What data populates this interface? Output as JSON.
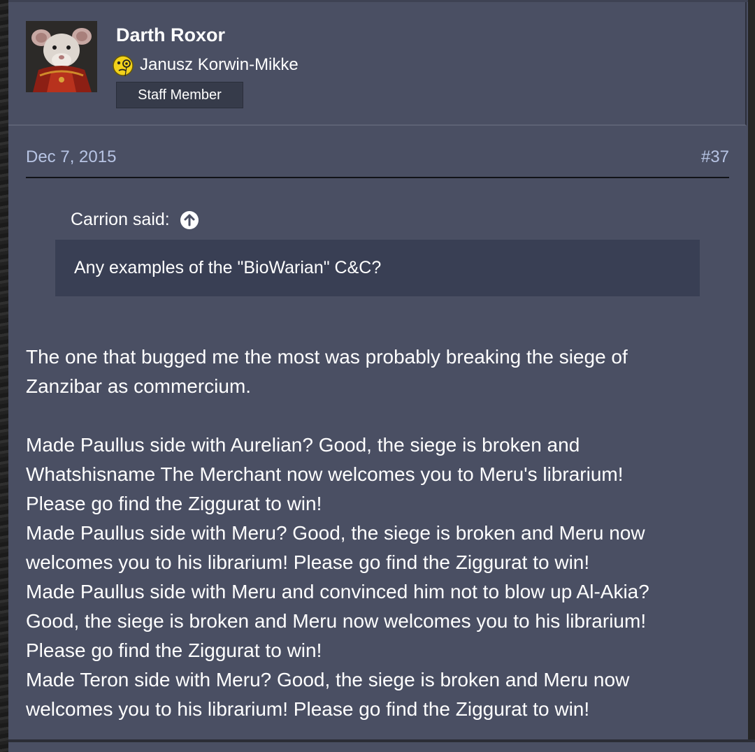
{
  "user": {
    "name": "Darth Roxor",
    "title": "Janusz Korwin-Mikke",
    "badge": "Staff Member",
    "avatar_icon": "rat-warrior-avatar",
    "title_icon": "monocle-smiley-icon"
  },
  "post": {
    "date": "Dec 7, 2015",
    "number": "#37",
    "quote": {
      "attribution": "Carrion said:",
      "attribution_icon": "arrow-up-circle-icon",
      "text": "Any examples of the \"BioWarian\" C&C?"
    },
    "body_lines": [
      "The one that bugged me the most was probably breaking the siege of",
      "Zanzibar as commercium.",
      "",
      "Made Paullus side with Aurelian? Good, the siege is broken and",
      "Whatshisname The Merchant now welcomes you to Meru's librarium!",
      "Please go find the Ziggurat to win!",
      "Made Paullus side with Meru? Good, the siege is broken and Meru now",
      "welcomes you to his librarium! Please go find the Ziggurat to win!",
      "Made Paullus side with Meru and convinced him not to blow up Al-Akia?",
      "Good, the siege is broken and Meru now welcomes you to his librarium!",
      "Please go find the Ziggurat to win!",
      "Made Teron side with Meru? Good, the siege is broken and Meru now",
      "welcomes you to his librarium! Please go find the Ziggurat to win!"
    ]
  },
  "colors": {
    "post_bg": "#4a4f63",
    "quote_bg": "#393f54",
    "meta_text": "#b7c4e4",
    "badge_bg": "#363b4a"
  }
}
